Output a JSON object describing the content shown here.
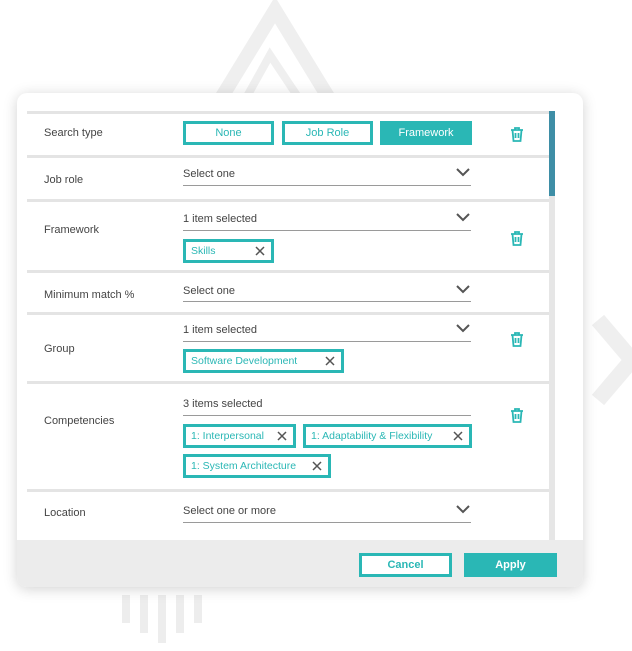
{
  "colors": {
    "accent": "#2ab7b5",
    "scroll_thumb": "#3e8ea6"
  },
  "search_type": {
    "label": "Search type",
    "options": [
      "None",
      "Job Role",
      "Framework"
    ],
    "selected": "Framework"
  },
  "job_role": {
    "label": "Job role",
    "value": "Select one"
  },
  "framework": {
    "label": "Framework",
    "value": "1 item selected",
    "chips": [
      "Skills"
    ]
  },
  "min_match": {
    "label": "Minimum match %",
    "value": "Select one"
  },
  "group": {
    "label": "Group",
    "value": "1 item selected",
    "chips": [
      "Software Development"
    ]
  },
  "competencies": {
    "label": "Competencies",
    "value": "3 items selected",
    "chips": [
      "1: Interpersonal",
      "1: Adaptability & Flexibility",
      "1: System Architecture"
    ]
  },
  "location": {
    "label": "Location",
    "value": "Select one or more"
  },
  "footer": {
    "cancel_label": "Cancel",
    "apply_label": "Apply"
  },
  "icons": {
    "delete": "trash-icon",
    "dropdown": "chevron-down-icon",
    "remove_chip": "close-icon"
  }
}
